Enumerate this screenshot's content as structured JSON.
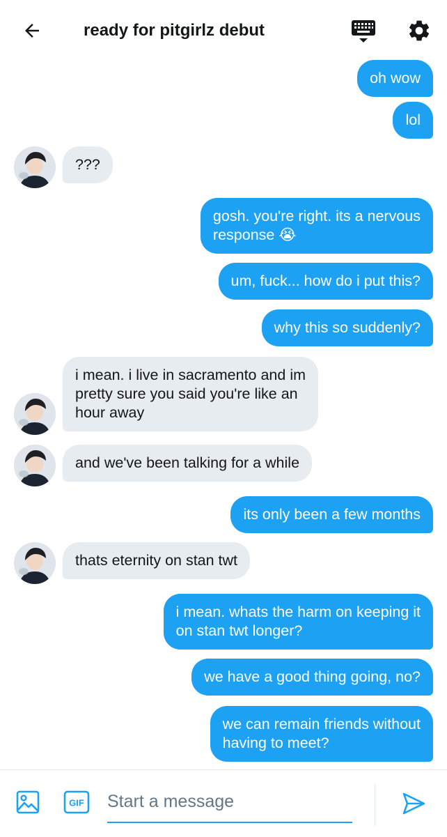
{
  "header": {
    "title": "ready for pitgirlz debut",
    "back_icon": "arrow-left-icon",
    "keyboard_icon": "keyboard-icon",
    "settings_icon": "gear-icon"
  },
  "messages": [
    {
      "direction": "outgoing",
      "text": "oh wow"
    },
    {
      "direction": "outgoing",
      "text": "lol"
    },
    {
      "direction": "incoming",
      "text": "???"
    },
    {
      "direction": "outgoing",
      "lines": [
        "gosh. you're right. its a nervous",
        "response 😭"
      ]
    },
    {
      "direction": "outgoing",
      "text": "um, fuck... how do i put this?"
    },
    {
      "direction": "outgoing",
      "text": "why this so suddenly?"
    },
    {
      "direction": "incoming",
      "lines": [
        "i mean. i live in sacramento and im",
        "pretty sure you said you're like an",
        "hour away"
      ]
    },
    {
      "direction": "incoming",
      "text": "and we've been talking for a while"
    },
    {
      "direction": "outgoing",
      "text": "its only been a few months"
    },
    {
      "direction": "incoming",
      "text": "thats eternity on stan twt"
    },
    {
      "direction": "outgoing",
      "lines": [
        "i mean. whats the harm on keeping it",
        "on stan twt longer?"
      ]
    },
    {
      "direction": "outgoing",
      "text": "we have a good thing going, no?"
    },
    {
      "direction": "outgoing",
      "lines": [
        "we can remain friends without",
        "having to meet?"
      ]
    }
  ],
  "composer": {
    "placeholder": "Start a message",
    "gif_label": "GIF",
    "image_icon": "image-icon",
    "send_icon": "send-icon"
  },
  "colors": {
    "accent": "#1da1f2",
    "incoming_bubble": "#e6ecf0",
    "text": "#14171a",
    "placeholder": "#657786"
  }
}
